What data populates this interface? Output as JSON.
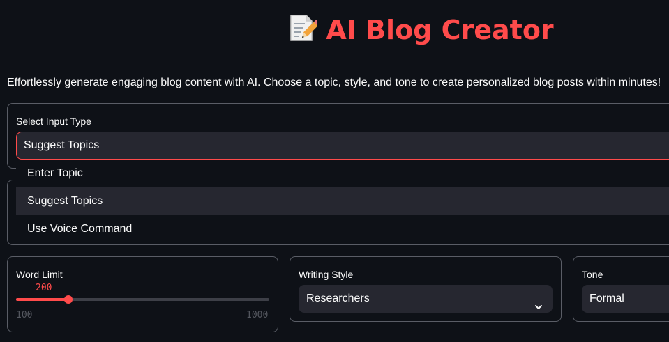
{
  "header": {
    "icon": "memo-icon",
    "title": "AI Blog Creator",
    "description": "Effortlessly generate engaging blog content with AI. Choose a topic, style, and tone to create personalized blog posts within minutes!"
  },
  "input_type": {
    "label": "Select Input Type",
    "value": "Suggest Topics",
    "options": [
      "Enter Topic",
      "Suggest Topics",
      "Use Voice Command"
    ],
    "highlighted_index": 1
  },
  "word_limit": {
    "label": "Word Limit",
    "value": 200,
    "value_text": "200",
    "min": 100,
    "max": 1000,
    "min_label": "100",
    "max_label": "1000"
  },
  "writing_style": {
    "label": "Writing Style",
    "value": "Researchers"
  },
  "tone": {
    "label": "Tone",
    "value": "Formal"
  },
  "colors": {
    "background": "#0e1117",
    "accent": "#ff4b4b",
    "widget": "#262730",
    "border": "#5a5d66",
    "text": "#fafafa"
  }
}
